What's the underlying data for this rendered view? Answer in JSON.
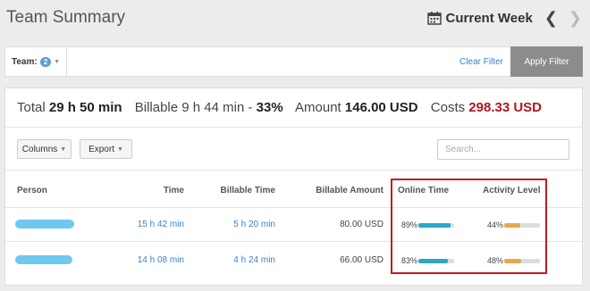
{
  "header": {
    "title": "Team Summary",
    "week_label": "Current Week",
    "prev_icon": "chevron-left-icon",
    "next_icon": "chevron-right-icon",
    "calendar_icon": "calendar-icon"
  },
  "filter_bar": {
    "team_label": "Team:",
    "team_count": "2",
    "clear_filter": "Clear Filter",
    "apply_filter": "Apply Filter"
  },
  "totals": {
    "total_label": "Total",
    "total_value": "29 h 50 min",
    "billable_label": "Billable 9 h 44 min -",
    "billable_pct": "33%",
    "amount_label": "Amount",
    "amount_value": "146.00 USD",
    "costs_label": "Costs",
    "costs_value": "298.33 USD"
  },
  "toolbar": {
    "columns_label": "Columns",
    "export_label": "Export",
    "search_placeholder": "Search..."
  },
  "table": {
    "headers": [
      "Person",
      "Time",
      "Billable Time",
      "Billable Amount",
      "Online Time",
      "Activity Level"
    ],
    "rows": [
      {
        "person": "",
        "time": "15 h 42 min",
        "billable_time": "5 h 20 min",
        "billable_amount": "80.00 USD",
        "online_pct": "89%",
        "online_level": 0.89,
        "activity_pct": "44%",
        "activity_level": 0.44
      },
      {
        "person": "",
        "time": "14 h 08 min",
        "billable_time": "4 h 24 min",
        "billable_amount": "66.00 USD",
        "online_pct": "83%",
        "online_level": 0.83,
        "activity_pct": "48%",
        "activity_level": 0.48
      }
    ]
  },
  "colors": {
    "link": "#3a7fc4",
    "costs": "#b0171f",
    "online_bar": "#2aa8c6",
    "activity_bar": "#e4a84e",
    "highlight": "#c41a22",
    "redacted_person": "#6ec8f0"
  }
}
